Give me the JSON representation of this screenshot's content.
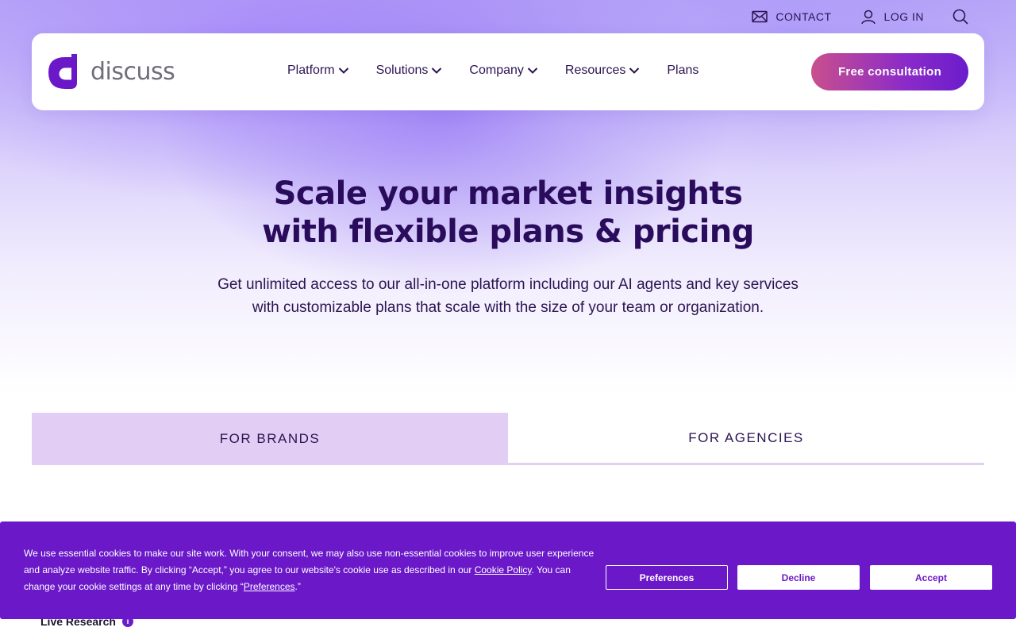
{
  "topbar": {
    "contact": {
      "label": "CONTACT",
      "icon": "mail-icon"
    },
    "login": {
      "label": "LOG IN",
      "icon": "user-icon"
    },
    "search": {
      "icon": "search-icon"
    }
  },
  "nav": {
    "logo_text": "discuss",
    "links": [
      {
        "label": "Platform",
        "has_dropdown": true
      },
      {
        "label": "Solutions",
        "has_dropdown": true
      },
      {
        "label": "Company",
        "has_dropdown": true
      },
      {
        "label": "Resources",
        "has_dropdown": true
      },
      {
        "label": "Plans",
        "has_dropdown": false
      }
    ],
    "cta_label": "Free consultation"
  },
  "hero": {
    "title_line1": "Scale your market insights",
    "title_line2": "with flexible plans & pricing",
    "subtitle_line1": "Get unlimited access to our all-in-one platform including our AI agents and key services",
    "subtitle_line2": "with customizable plans that scale with the size of your team or organization."
  },
  "tabs": [
    {
      "label": "FOR BRANDS",
      "active": true
    },
    {
      "label": "FOR AGENCIES",
      "active": false
    }
  ],
  "pricing_row": {
    "first_label": "Live Research"
  },
  "cookie_banner": {
    "text_part1": "We use essential cookies to make our site work. With your consent, we may also use non-essential cookies to improve user experience and analyze website traffic. By clicking “Accept,” you agree to our website's cookie use as described in our ",
    "cookie_policy_link": "Cookie Policy",
    "text_part2": ". You can change your cookie settings at any time by clicking “",
    "preferences_link": "Preferences",
    "text_part3": ".”",
    "preferences_button": "Preferences",
    "decline_button": "Decline",
    "accept_button": "Accept"
  },
  "colors": {
    "brand_purple": "#6b18c9",
    "cta_gradient_start": "#c94f8d",
    "heading": "#2a0c5c",
    "active_tab_bg": "#e2cef4"
  }
}
